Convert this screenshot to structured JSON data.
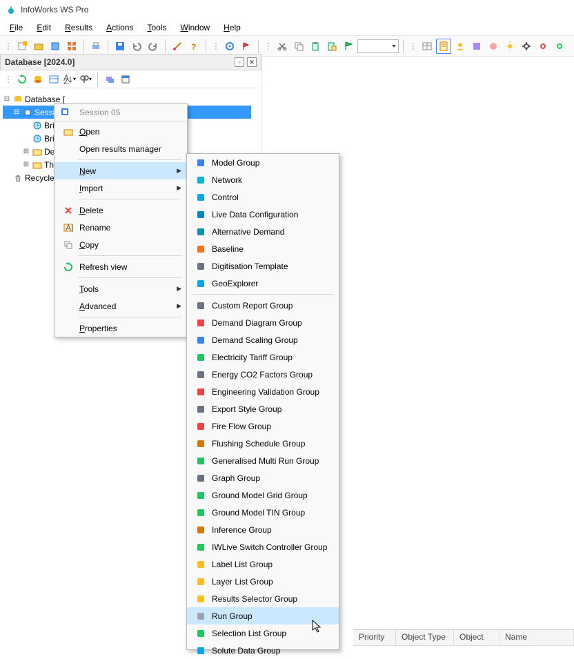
{
  "app": {
    "title": "InfoWorks WS Pro"
  },
  "menu": {
    "file": "File",
    "edit": "Edit",
    "results": "Results",
    "actions": "Actions",
    "tools": "Tools",
    "window": "Window",
    "help": "Help"
  },
  "panel": {
    "title": "Database [2024.0]"
  },
  "tree": {
    "root": "Database [",
    "session": "Session",
    "bridg1": "Bridg",
    "bridg2": "Bridg",
    "dem": "Dem",
    "then": "Then",
    "recycle": "Recycle Bin"
  },
  "ctx": {
    "header": "Session 05",
    "open": "Open",
    "openres": "Open results manager",
    "new": "New",
    "import": "Import",
    "delete": "Delete",
    "rename": "Rename",
    "copy": "Copy",
    "refresh": "Refresh view",
    "tools": "Tools",
    "advanced": "Advanced",
    "properties": "Properties"
  },
  "sub": [
    "Model Group",
    "Network",
    "Control",
    "Live Data Configuration",
    "Alternative Demand",
    "Baseline",
    "Digitisation Template",
    "GeoExplorer",
    "Custom Report Group",
    "Demand Diagram Group",
    "Demand Scaling Group",
    "Electricity Tariff Group",
    "Energy CO2 Factors Group",
    "Engineering Validation Group",
    "Export Style Group",
    "Fire Flow Group",
    "Flushing Schedule Group",
    "Generalised Multi Run Group",
    "Graph Group",
    "Ground Model Grid Group",
    "Ground Model TIN Group",
    "Inference Group",
    "IWLive Switch Controller Group",
    "Label List Group",
    "Layer List Group",
    "Results Selector Group",
    "Run Group",
    "Selection List Group",
    "Solute Data Group"
  ],
  "table": {
    "c1": "Priority",
    "c2": "Object Type",
    "c3": "Object",
    "c4": "Name"
  }
}
